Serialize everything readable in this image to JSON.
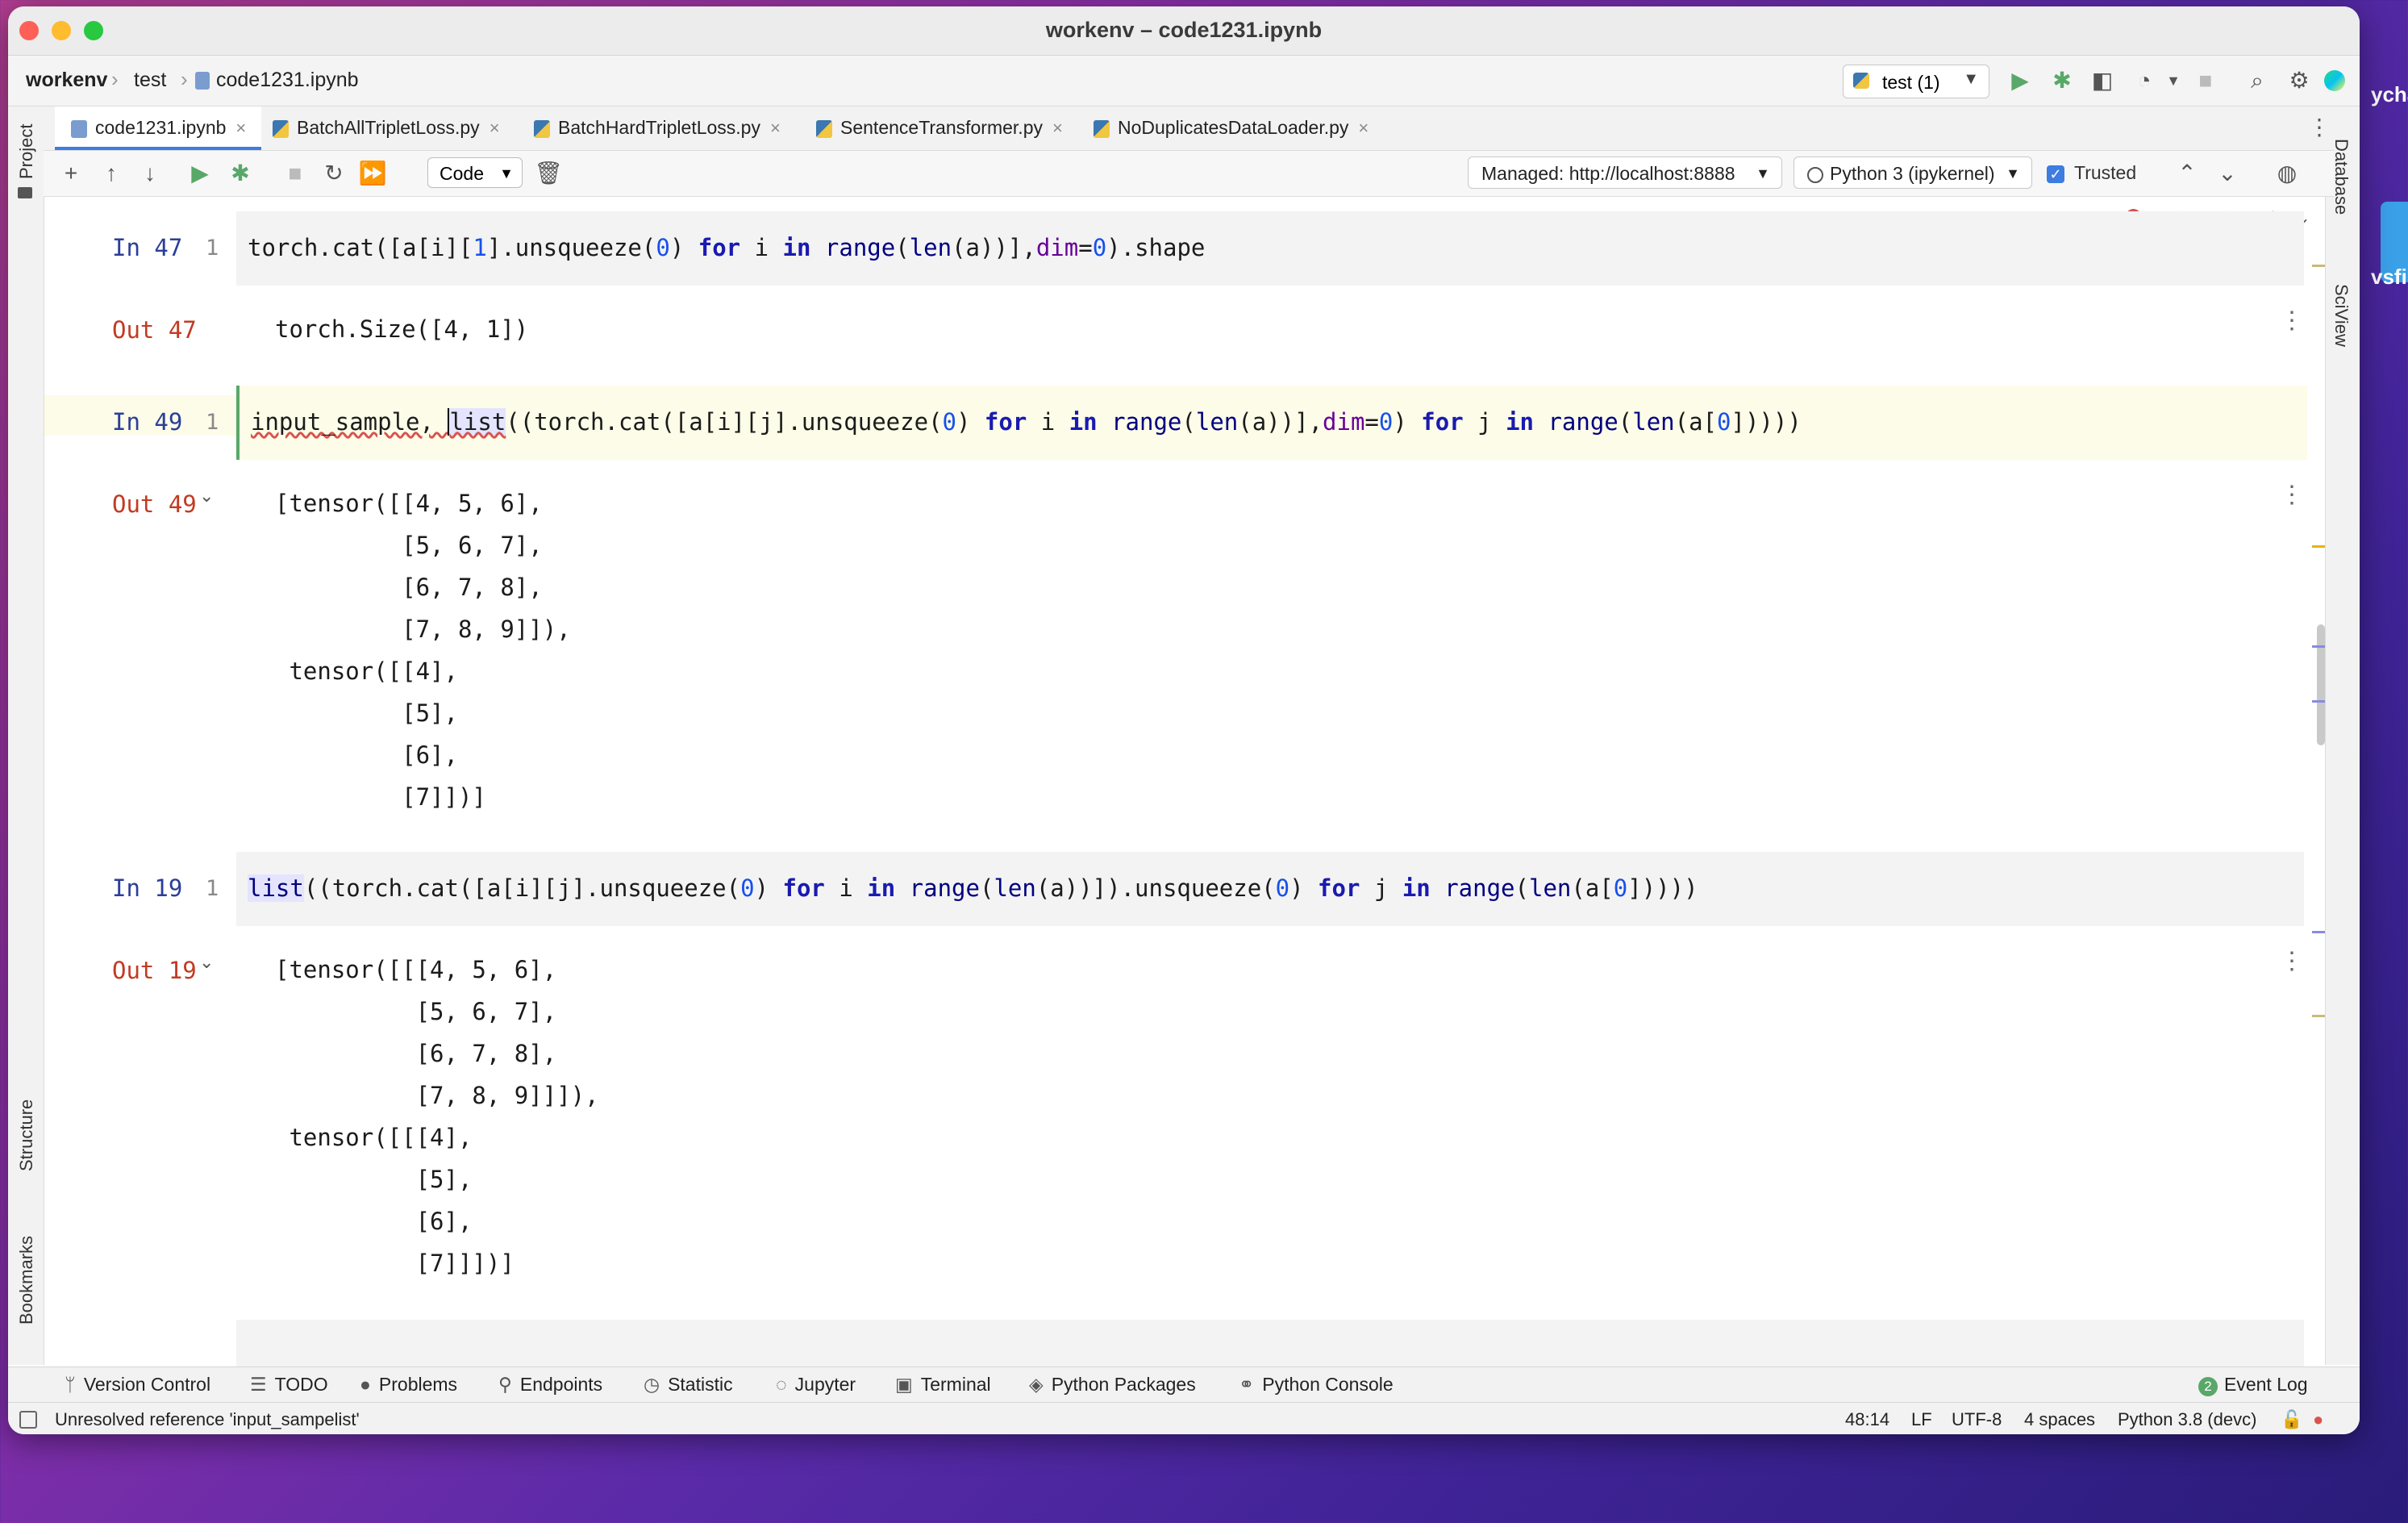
{
  "window": {
    "title": "workenv – code1231.ipynb"
  },
  "breadcrumb": {
    "project": "workenv",
    "folder": "test",
    "file": "code1231.ipynb"
  },
  "run_config": {
    "label": "test (1)"
  },
  "tabs": [
    {
      "label": "code1231.ipynb",
      "active": true
    },
    {
      "label": "BatchAllTripletLoss.py",
      "active": false
    },
    {
      "label": "BatchHardTripletLoss.py",
      "active": false
    },
    {
      "label": "SentenceTransformer.py",
      "active": false
    },
    {
      "label": "NoDuplicatesDataLoader.py",
      "active": false
    }
  ],
  "notebook_toolbar": {
    "cell_type": "Code",
    "server": "Managed: http://localhost:8888",
    "kernel": "Python 3 (ipykernel)",
    "trusted": "Trusted"
  },
  "inspections": {
    "errors": "1",
    "warnings": "1",
    "weak_warnings": "2"
  },
  "side_panels": {
    "left": [
      "Project",
      "Structure",
      "Bookmarks"
    ],
    "right": [
      "Database",
      "SciView"
    ]
  },
  "cells": [
    {
      "in_label": "In 47",
      "line": "1",
      "code": "torch.cat([a[i][1].unsqueeze(0) for i in range(len(a))],dim=0).shape",
      "out_label": "Out 47",
      "output": "torch.Size([4, 1])"
    },
    {
      "in_label": "In 49",
      "line": "1",
      "code": "input_sample, list((torch.cat([a[i][j].unsqueeze(0) for i in range(len(a))],dim=0) for j in range(len(a[0]))))",
      "out_label": "Out 49",
      "output": "[tensor([[4, 5, 6],\n         [5, 6, 7],\n         [6, 7, 8],\n         [7, 8, 9]]),\n tensor([[4],\n         [5],\n         [6],\n         [7]])]"
    },
    {
      "in_label": "In 19",
      "line": "1",
      "code": "list((torch.cat([a[i][j].unsqueeze(0) for i in range(len(a))]).unsqueeze(0) for j in range(len(a[0]))))",
      "out_label": "Out 19",
      "output": "[tensor([[[4, 5, 6],\n          [5, 6, 7],\n          [6, 7, 8],\n          [7, 8, 9]]]),\n tensor([[[4],\n          [5],\n          [6],\n          [7]]])]"
    }
  ],
  "bottom_tools": [
    "Version Control",
    "TODO",
    "Problems",
    "Endpoints",
    "Statistic",
    "Jupyter",
    "Terminal",
    "Python Packages",
    "Python Console"
  ],
  "event_log": {
    "count": "2",
    "label": "Event Log"
  },
  "status": {
    "message": "Unresolved reference 'input_sampelist'",
    "position": "48:14",
    "line_sep": "LF",
    "encoding": "UTF-8",
    "indent": "4 spaces",
    "interpreter": "Python 3.8 (devc)"
  },
  "desktop": {
    "label1": "ychar",
    "label2": "vsfi"
  },
  "colors": {
    "accent": "#3d7ce0",
    "in_prompt": "#2a3e9a",
    "out_prompt": "#c23b22",
    "run": "#59a869"
  }
}
